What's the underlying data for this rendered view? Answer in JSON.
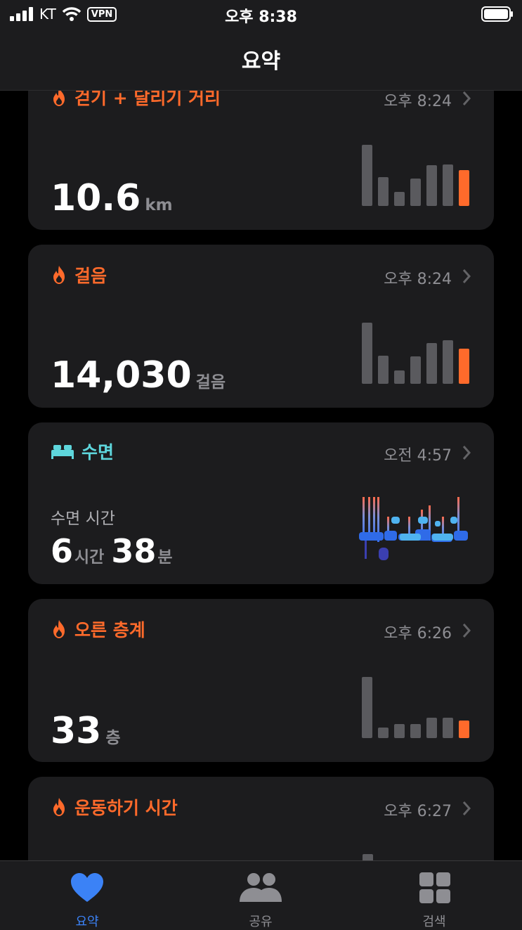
{
  "status": {
    "carrier": "KT",
    "vpn": "VPN",
    "time": "오후 8:38"
  },
  "nav": {
    "title": "요약"
  },
  "colors": {
    "orange": "#ff6a2b",
    "teal": "#5ed6dc",
    "blue": "#3b82f6",
    "bar_gray": "#5a5a5e"
  },
  "cards": {
    "distance": {
      "title": "걷기 + 달리기 거리",
      "time": "오후 8:24",
      "value": "10.6",
      "unit": "km",
      "bars": [
        0.97,
        0.46,
        0.22,
        0.43,
        0.64,
        0.66,
        0.57
      ]
    },
    "steps": {
      "title": "걸음",
      "time": "오후 8:24",
      "value": "14,030",
      "unit": "걸음",
      "bars": [
        0.97,
        0.44,
        0.21,
        0.43,
        0.64,
        0.69,
        0.55
      ]
    },
    "sleep": {
      "title": "수면",
      "time": "오전 4:57",
      "label": "수면 시간",
      "hours": "6",
      "hours_unit": "시간",
      "minutes": "38",
      "minutes_unit": "분"
    },
    "floors": {
      "title": "오른 층계",
      "time": "오후 6:26",
      "value": "33",
      "unit": "층",
      "bars": [
        0.97,
        0.17,
        0.22,
        0.22,
        0.32,
        0.32,
        0.28
      ]
    },
    "exercise": {
      "title": "운동하기 시간",
      "time": "오후 6:27"
    }
  },
  "tabs": {
    "summary": "요약",
    "sharing": "공유",
    "browse": "검색"
  },
  "icons": {
    "flame": "flame-icon",
    "bed": "bed-icon",
    "heart": "heart-icon",
    "people": "people-icon",
    "grid": "grid-icon"
  }
}
